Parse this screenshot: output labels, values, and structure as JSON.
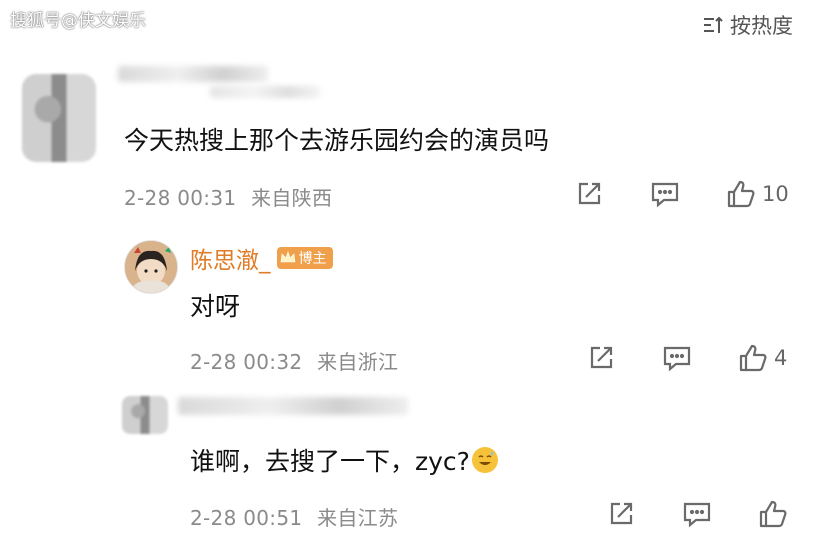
{
  "watermark": "搜狐号@侠文娱乐",
  "sort": {
    "label": "按热度",
    "icon": "sort-icon"
  },
  "comment": {
    "text": "今天热搜上那个去游乐园约会的演员吗",
    "time": "2-28 00:31",
    "location": "来自陕西",
    "likes": "10"
  },
  "replies": [
    {
      "author": "陈思澈_",
      "badge": "博主",
      "text": "对呀",
      "time": "2-28 00:32",
      "location": "来自浙江",
      "likes": "4"
    },
    {
      "text": "谁啊，去搜了一下，zyc?",
      "emoji": "grinning-sweat-emoji",
      "time": "2-28 00:51",
      "location": "来自江苏",
      "likes": ""
    }
  ],
  "icons": {
    "share": "share-icon",
    "comment": "comment-icon",
    "like": "thumbs-up-icon"
  },
  "colors": {
    "author": "#e07b26",
    "badge": "#f0a04a",
    "meta": "#8a8a8a"
  }
}
